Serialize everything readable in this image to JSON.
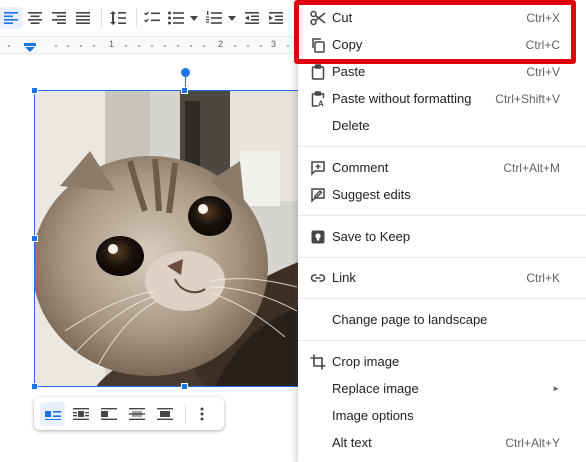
{
  "ruler": {
    "num_1": "1",
    "num_2": "2",
    "num_3": "3"
  },
  "toolbar": {
    "icons": [
      "align-left-icon",
      "align-center-icon",
      "align-right-icon",
      "align-justify-icon",
      "line-spacing-icon",
      "checklist-icon",
      "bulleted-list-icon",
      "numbered-list-icon",
      "decrease-indent-icon",
      "increase-indent-icon"
    ]
  },
  "wrap_toolbar": {
    "icons": [
      "inline-icon",
      "wrap-text-icon",
      "break-text-icon",
      "behind-text-icon",
      "in-front-of-text-icon",
      "more-options-icon"
    ],
    "active": "inline"
  },
  "menu": {
    "cut": {
      "label": "Cut",
      "shortcut": "Ctrl+X",
      "icon": "scissors-icon"
    },
    "copy": {
      "label": "Copy",
      "shortcut": "Ctrl+C",
      "icon": "copy-icon"
    },
    "paste": {
      "label": "Paste",
      "shortcut": "Ctrl+V",
      "icon": "clipboard-icon"
    },
    "paste_plain": {
      "label": "Paste without formatting",
      "shortcut": "Ctrl+Shift+V",
      "icon": "clipboard-text-icon"
    },
    "delete": {
      "label": "Delete"
    },
    "comment": {
      "label": "Comment",
      "shortcut": "Ctrl+Alt+M",
      "icon": "comment-icon"
    },
    "suggest": {
      "label": "Suggest edits",
      "icon": "suggest-edits-icon"
    },
    "keep": {
      "label": "Save to Keep",
      "icon": "keep-icon"
    },
    "link": {
      "label": "Link",
      "shortcut": "Ctrl+K",
      "icon": "link-icon"
    },
    "landscape": {
      "label": "Change page to landscape"
    },
    "crop": {
      "label": "Crop image",
      "icon": "crop-icon"
    },
    "replace": {
      "label": "Replace image",
      "submenu_indicator": "►"
    },
    "options": {
      "label": "Image options"
    },
    "alt": {
      "label": "Alt text",
      "shortcut": "Ctrl+Alt+Y"
    }
  },
  "colors": {
    "highlight": "#e3000f",
    "selection": "#1a73e8",
    "text": "#202124",
    "shortcut": "#5f6368"
  }
}
